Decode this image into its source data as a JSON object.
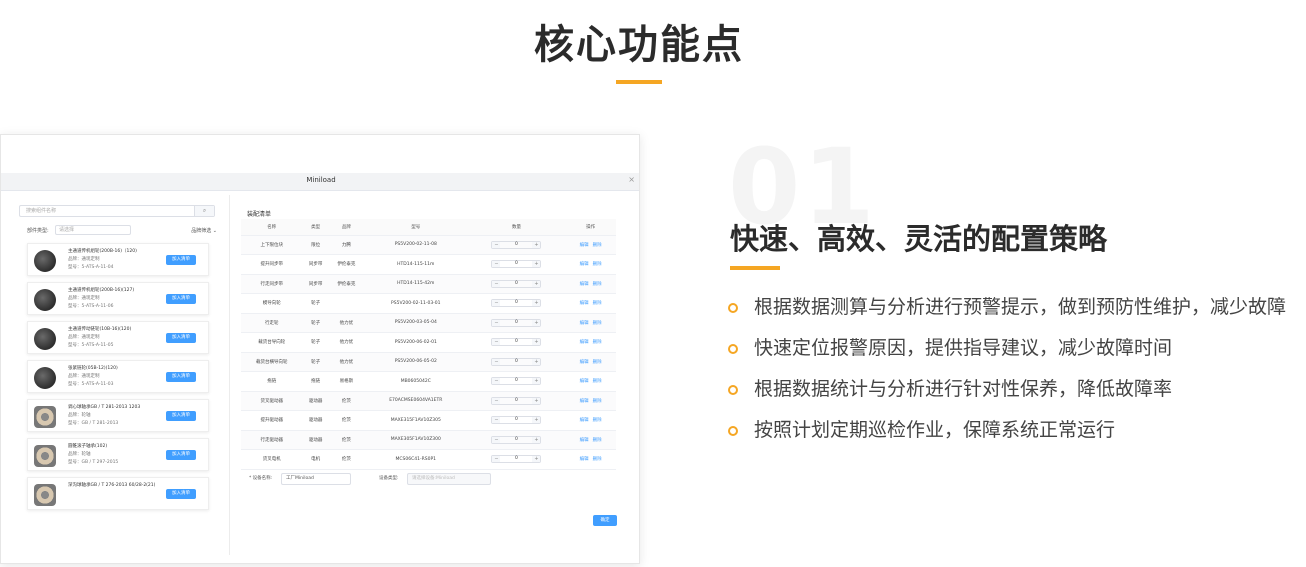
{
  "page": {
    "title": "核心功能点"
  },
  "screenshot": {
    "modal_title": "Miniload",
    "close": "×",
    "search_placeholder": "搜索组件名称",
    "search_btn": "⌕",
    "filter_label": "部件类型:",
    "filter_value": "请选择",
    "brand_filter": "品牌筛选 ⌄",
    "products": [
      {
        "name": "主通道传机组轮(200B-16)（120)",
        "brand": "品牌：通现定制",
        "model": "型号：5-ATS-A-11-04",
        "type": "wheel"
      },
      {
        "name": "主通道传机组轮(200B-16)(127)",
        "brand": "品牌：通现定制",
        "model": "型号：5-ATS-A-11-06",
        "type": "wheel"
      },
      {
        "name": "主通道传动链轮(10B-16)(120)",
        "brand": "品牌：通现定制",
        "model": "型号：5-ATS-A-11-05",
        "type": "wheel"
      },
      {
        "name": "张紧链轮(05B-12)(120)",
        "brand": "品牌：通现定制",
        "model": "型号：5-ATS-A-11-03",
        "type": "wheel"
      },
      {
        "name": "调心球轴承GB / T 281-2013 1203",
        "brand": "品牌：轮轴",
        "model": "型号：GB / T 281-2013",
        "type": "bearing"
      },
      {
        "name": "圆锥滚子轴承(102)",
        "brand": "品牌：轮轴",
        "model": "型号：GB / T 297-2015",
        "type": "bearing"
      },
      {
        "name": "深沟球轴承GB / T 276-2013 60/28-2(21)",
        "brand": "",
        "model": "",
        "type": "bearing"
      }
    ],
    "add_label": "加入清单",
    "config_title": "装配清单",
    "table_headers": [
      "名称",
      "类型",
      "品牌",
      "型号",
      "数量",
      "操作"
    ],
    "rows": [
      [
        "上下限位块",
        "限位",
        "力腾",
        "PS5V200-02-11-08",
        "0"
      ],
      [
        "提升同步带",
        "同步带",
        "伊伦泰克",
        "HTD14-115-11m",
        "0"
      ],
      [
        "行走同步带",
        "同步带",
        "伊伦泰克",
        "HTD14-115-42m",
        "0"
      ],
      [
        "模导向轮",
        "轮子",
        "",
        "PS5V200-02-11-03-01",
        "0"
      ],
      [
        "行走轮",
        "轮子",
        "他力优",
        "PS5V200-03-05-04",
        "0"
      ],
      [
        "载货台导向轮",
        "轮子",
        "他力优",
        "PS5V200-06-02-01",
        "0"
      ],
      [
        "载货台横导向轮",
        "轮子",
        "他力优",
        "PS5V200-06-05-02",
        "0"
      ],
      [
        "拖链",
        "拖链",
        "易格斯",
        "MB0605042C",
        "0"
      ],
      [
        "货叉驱动器",
        "驱动器",
        "伦茨",
        "E70ACMSE0604VA1ETR",
        "0"
      ],
      [
        "提升驱动器",
        "驱动器",
        "伦茨",
        "MAXE315F1AV10Z305",
        "0"
      ],
      [
        "行走驱动器",
        "驱动器",
        "伦茨",
        "MAXE305F1AV10Z300",
        "0"
      ],
      [
        "货叉电机",
        "电机",
        "伦茨",
        "MCS06C41-RS0P1",
        "0"
      ]
    ],
    "op_edit": "编辑",
    "op_delete": "删除",
    "device_name_label": "* 设备名称:",
    "device_name_value": "工厂Miniload",
    "device_type_label": "设备类型:",
    "device_type_placeholder": "请选择设备:Miniload",
    "confirm_label": "确定"
  },
  "feature": {
    "number": "01",
    "title": "快速、高效、灵活的配置策略",
    "bullets": [
      "根据数据测算与分析进行预警提示，做到预防性维护，减少故障",
      "快速定位报警原因，提供指导建议，减少故障时间",
      "根据数据统计与分析进行针对性保养，降低故障率",
      "按照计划定期巡检作业，保障系统正常运行"
    ]
  }
}
